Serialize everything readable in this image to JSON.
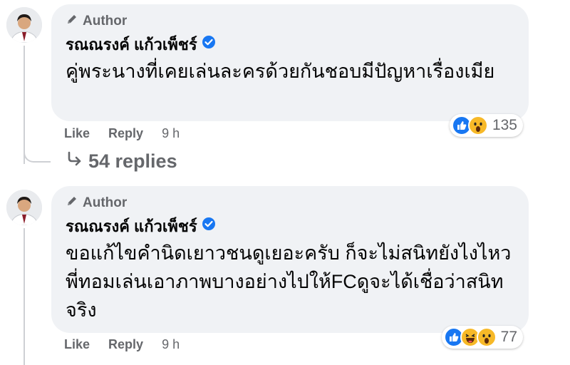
{
  "comments": [
    {
      "author_badge": "Author",
      "name": "รณณรงค์ แก้วเพ็ชร์",
      "text": "คู่พระนางที่เคยเล่นละครด้วยกันชอบมีปัญหาเรื่องเมีย",
      "reactions": [
        "like",
        "wow"
      ],
      "reaction_count": "135",
      "like_label": "Like",
      "reply_label": "Reply",
      "time": "9 h",
      "replies_label": "54 replies"
    },
    {
      "author_badge": "Author",
      "name": "รณณรงค์ แก้วเพ็ชร์",
      "text": "ขอแก้ไขคำนิดเยาวชนดูเยอะครับ ก็จะไม่สนิทยังไงไหวพี่ทอมเล่นเอาภาพบางอย่างไปให้FCดูจะได้เชื่อว่าสนิทจริง",
      "reactions": [
        "like",
        "haha",
        "wow"
      ],
      "reaction_count": "77",
      "like_label": "Like",
      "reply_label": "Reply",
      "time": "9 h"
    }
  ],
  "colors": {
    "bubble": "#f0f2f5",
    "secondary_text": "#65676b",
    "like_blue": "#1877f2",
    "emoji_yellow": "#f7b928"
  }
}
